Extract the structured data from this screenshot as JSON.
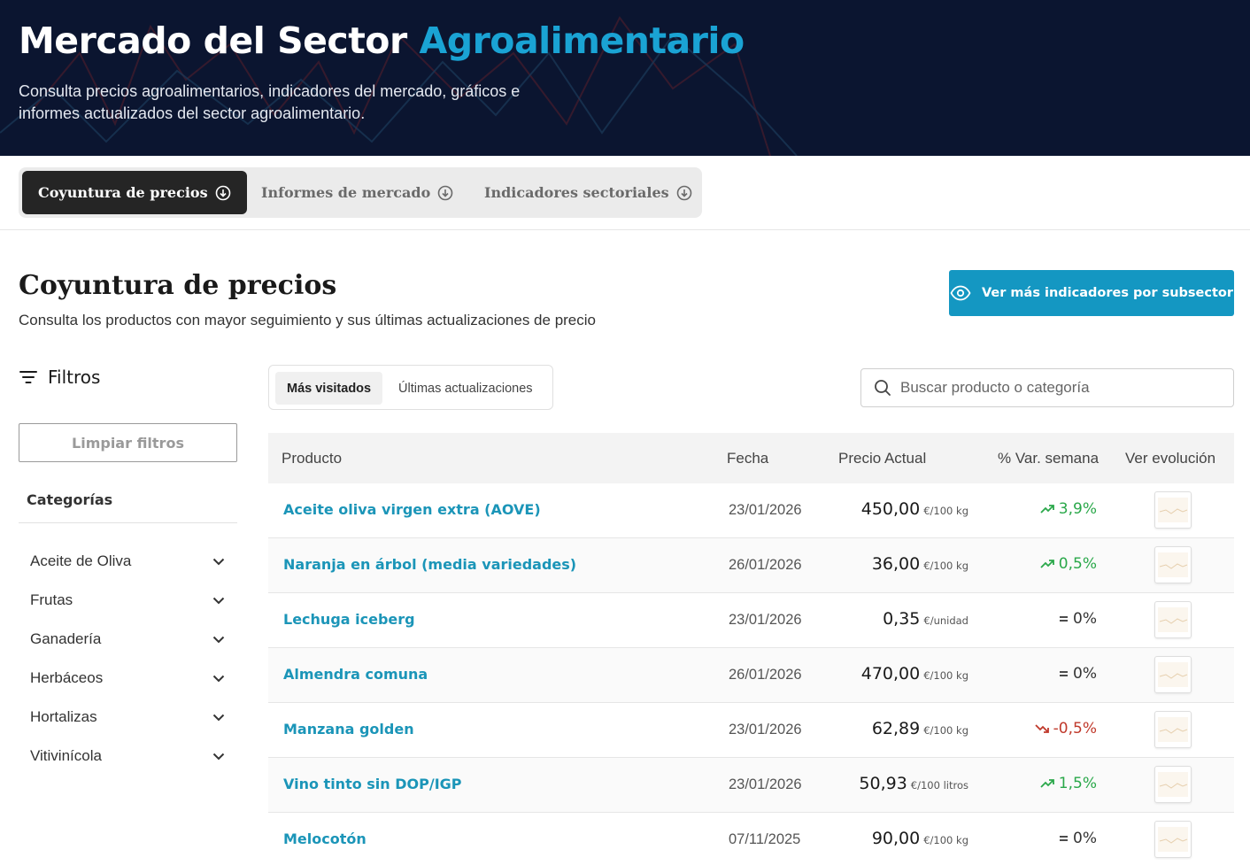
{
  "hero": {
    "title_main": "Mercado del Sector",
    "title_accent": "Agroalimentario",
    "subtitle": "Consulta precios agroalimentarios, indicadores del mercado, gráficos e informes actualizados del sector agroalimentario."
  },
  "tabs": [
    {
      "label": "Coyuntura de precios",
      "active": true
    },
    {
      "label": "Informes de mercado",
      "active": false
    },
    {
      "label": "Indicadores sectoriales",
      "active": false
    }
  ],
  "section": {
    "title": "Coyuntura de precios",
    "subtitle": "Consulta los productos con mayor seguimiento y sus últimas actualizaciones de precio",
    "cta_label": "Ver más indicadores por subsector"
  },
  "sidebar": {
    "filters_label": "Filtros",
    "clear_label": "Limpiar filtros",
    "categories_label": "Categorías",
    "categories": [
      "Aceite de Oliva",
      "Frutas",
      "Ganadería",
      "Herbáceos",
      "Hortalizas",
      "Vitivinícola"
    ]
  },
  "toggle": {
    "options": [
      "Más visitados",
      "Últimas actualizaciones"
    ],
    "active_index": 0
  },
  "search": {
    "placeholder": "Buscar producto o categoría",
    "value": ""
  },
  "table": {
    "headers": [
      "Producto",
      "Fecha",
      "Precio Actual",
      "% Var. semana",
      "Ver evolución"
    ],
    "rows": [
      {
        "product": "Aceite oliva virgen extra (AOVE)",
        "date": "23/01/2026",
        "price": "450,00",
        "unit": "€/100 kg",
        "variation": "3,9%",
        "trend": "up"
      },
      {
        "product": "Naranja en árbol (media variedades)",
        "date": "26/01/2026",
        "price": "36,00",
        "unit": "€/100 kg",
        "variation": "0,5%",
        "trend": "up"
      },
      {
        "product": "Lechuga iceberg",
        "date": "23/01/2026",
        "price": "0,35",
        "unit": "€/unidad",
        "variation": "0%",
        "trend": "flat"
      },
      {
        "product": "Almendra comuna",
        "date": "26/01/2026",
        "price": "470,00",
        "unit": "€/100 kg",
        "variation": "0%",
        "trend": "flat"
      },
      {
        "product": "Manzana golden",
        "date": "23/01/2026",
        "price": "62,89",
        "unit": "€/100 kg",
        "variation": "-0,5%",
        "trend": "down"
      },
      {
        "product": "Vino tinto sin DOP/IGP",
        "date": "23/01/2026",
        "price": "50,93",
        "unit": "€/100 litros",
        "variation": "1,5%",
        "trend": "up"
      },
      {
        "product": "Melocotón",
        "date": "07/11/2025",
        "price": "90,00",
        "unit": "€/100 kg",
        "variation": "0%",
        "trend": "flat"
      }
    ]
  },
  "colors": {
    "hero_bg": "#0b1530",
    "accent": "#1aa3d4",
    "link": "#1b95b8",
    "cta": "#1497c2",
    "up": "#2aa84a",
    "down": "#c0392b"
  },
  "icons": {
    "tab_icon": "arrow-down-circle-icon",
    "cta_icon": "eye-icon",
    "filters_icon": "filter-lines-icon",
    "category_icon": "chevron-down-icon",
    "search_icon": "search-icon",
    "trend_up_icon": "trend-up-icon",
    "trend_down_icon": "trend-down-icon",
    "trend_flat_icon": "equals-icon"
  }
}
